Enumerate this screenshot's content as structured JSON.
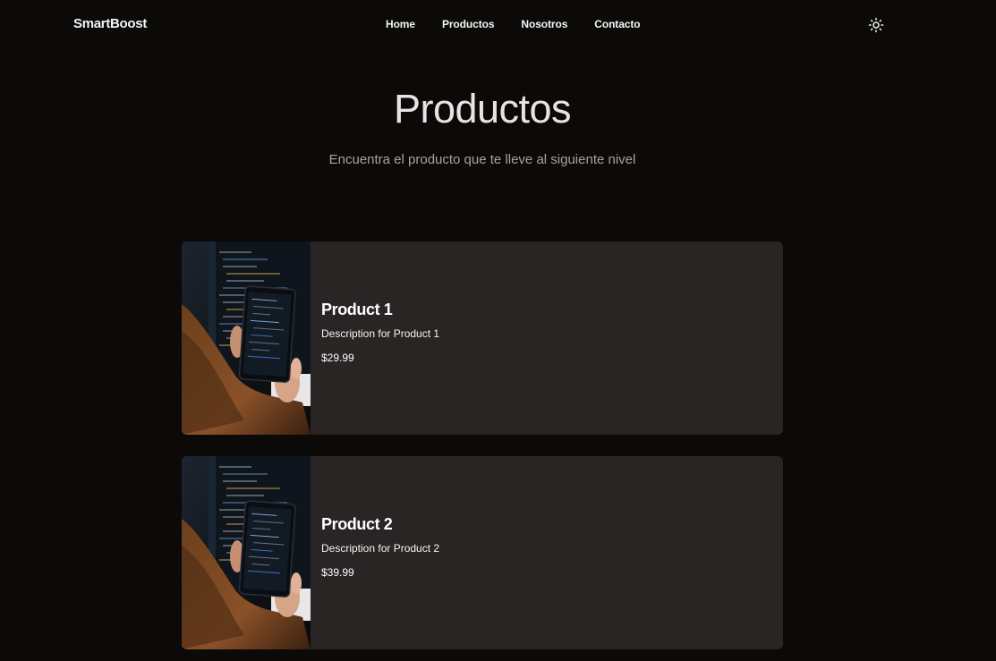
{
  "header": {
    "brand": "SmartBoost",
    "nav": [
      {
        "label": "Home"
      },
      {
        "label": "Productos"
      },
      {
        "label": "Nosotros"
      },
      {
        "label": "Contacto"
      }
    ],
    "theme_toggle_icon": "sun-icon"
  },
  "hero": {
    "title": "Productos",
    "subtitle": "Encuentra el producto que te lleve al siguiente nivel"
  },
  "products": [
    {
      "title": "Product 1",
      "description": "Description for Product 1",
      "price": "$29.99"
    },
    {
      "title": "Product 2",
      "description": "Description for Product 2",
      "price": "$39.99"
    }
  ],
  "colors": {
    "background": "#0c0a09",
    "card": "#292524",
    "text": "#fafaf9",
    "muted": "#a8a29e"
  }
}
